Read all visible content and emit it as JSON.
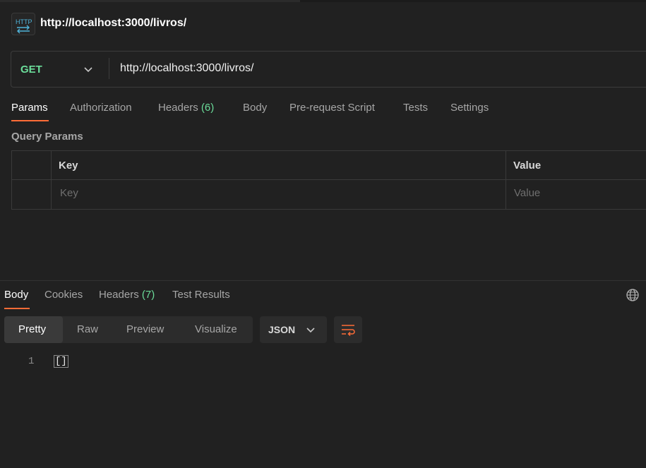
{
  "header": {
    "title": "http://localhost:3000/livros/",
    "icon": "http-icon",
    "icon_text": "HTTP"
  },
  "request": {
    "method": "GET",
    "url": "http://localhost:3000/livros/",
    "method_color": "#6bdd9a"
  },
  "request_tabs": [
    {
      "label": "Params",
      "active": true
    },
    {
      "label": "Authorization"
    },
    {
      "label": "Headers",
      "count": "(6)"
    },
    {
      "label": "Body"
    },
    {
      "label": "Pre-request Script"
    },
    {
      "label": "Tests"
    },
    {
      "label": "Settings"
    }
  ],
  "query_params": {
    "title": "Query Params",
    "columns": [
      "Key",
      "Value"
    ],
    "placeholders": {
      "key": "Key",
      "value": "Value"
    }
  },
  "response_tabs": [
    {
      "label": "Body",
      "active": true
    },
    {
      "label": "Cookies"
    },
    {
      "label": "Headers",
      "count": "(7)"
    },
    {
      "label": "Test Results"
    }
  ],
  "view_modes": [
    {
      "label": "Pretty",
      "active": true
    },
    {
      "label": "Raw"
    },
    {
      "label": "Preview"
    },
    {
      "label": "Visualize"
    }
  ],
  "format": {
    "selected": "JSON"
  },
  "response_body": {
    "lines": [
      {
        "number": "1",
        "text": "[]"
      }
    ]
  },
  "colors": {
    "accent": "#ff6c37",
    "count": "#6bdd9a",
    "background": "#212121"
  }
}
